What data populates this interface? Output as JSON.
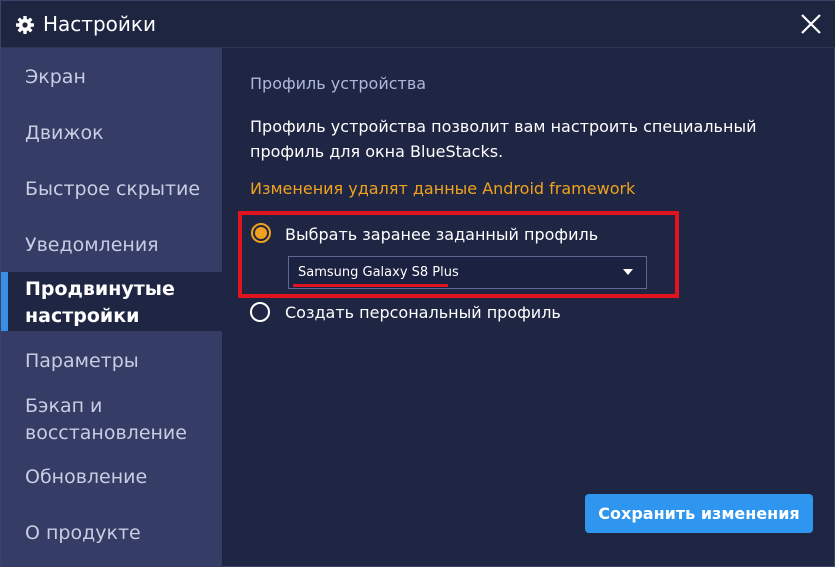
{
  "window": {
    "title": "Настройки",
    "icon": "gear-icon",
    "close_icon": "close-icon"
  },
  "sidebar": {
    "items": [
      {
        "label": "Экран",
        "active": false
      },
      {
        "label": "Движок",
        "active": false
      },
      {
        "label": "Быстрое скрытие",
        "active": false
      },
      {
        "label": "Уведомления",
        "active": false
      },
      {
        "label": "Продвинутые настройки",
        "active": true
      },
      {
        "label": "Параметры",
        "active": false
      },
      {
        "label": "Бэкап и восстановление",
        "active": false
      },
      {
        "label": "Обновление",
        "active": false
      },
      {
        "label": "О продукте",
        "active": false
      }
    ]
  },
  "content": {
    "section_title": "Профиль устройства",
    "description": "Профиль устройства позволит вам настроить специальный профиль для окна BlueStacks.",
    "warning": "Изменения удалят данные Android framework",
    "options": {
      "predefined": {
        "label": "Выбрать заранее заданный профиль",
        "checked": true
      },
      "custom": {
        "label": "Создать персональный профиль",
        "checked": false
      }
    },
    "profile_select": {
      "value": "Samsung Galaxy S8 Plus"
    },
    "save_button": "Сохранить изменения"
  },
  "colors": {
    "background": "#1f2643",
    "sidebar": "#353c66",
    "accent": "#2f96ef",
    "warning": "#f0a21e",
    "annotation": "#e0141f"
  }
}
